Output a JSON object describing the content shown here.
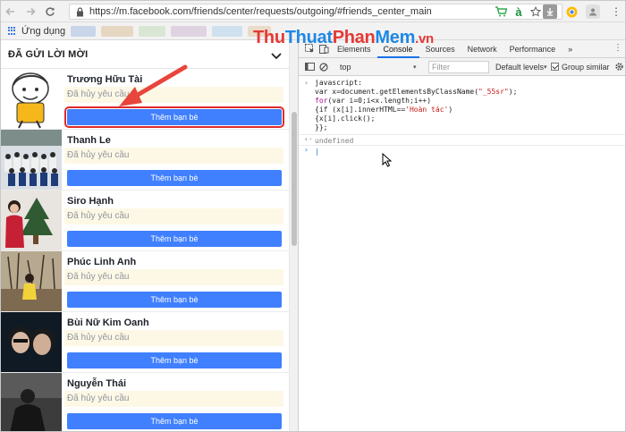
{
  "browser": {
    "url": "https://m.facebook.com/friends/center/requests/outgoing/#friends_center_main",
    "bookmark_apps_label": "Ứng dụng"
  },
  "page": {
    "title": "ĐÃ GỬI LỜI MỜI",
    "requests": [
      {
        "name": "Trương Hữu Tài",
        "status": "Đã hủy yêu cầu",
        "button": "Thêm bạn bè"
      },
      {
        "name": "Thanh Le",
        "status": "Đã hủy yêu cầu",
        "button": "Thêm bạn bè"
      },
      {
        "name": "Siro Hạnh",
        "status": "Đã hủy yêu cầu",
        "button": "Thêm bạn bè"
      },
      {
        "name": "Phúc Linh Anh",
        "status": "Đã hủy yêu cầu",
        "button": "Thêm bạn bè"
      },
      {
        "name": "Bùi Nữ Kim Oanh",
        "status": "Đã hủy yêu cầu",
        "button": "Thêm bạn bè"
      },
      {
        "name": "Nguyễn Thái",
        "status": "Đã hủy yêu cầu",
        "button": "Thêm bạn bè"
      }
    ]
  },
  "devtools": {
    "tabs": [
      "Elements",
      "Console",
      "Sources",
      "Network",
      "Performance"
    ],
    "more": "»",
    "context": "top",
    "filter_placeholder": "Filter",
    "levels": "Default levels",
    "group_similar": "Group similar",
    "code": {
      "l1": "javascript:",
      "l2a": "var x=document.getElementsByClassName(",
      "l2b": "\"_55sr\"",
      "l2c": ");",
      "l3a": "for",
      "l3b": "(var i=0;i<x.length;i++)",
      "l4a": "{if (x[i].innerHTML==",
      "l4b": "'Hoàn tác'",
      "l4c": ")",
      "l5": "{x[i].click();",
      "l6": "}};",
      "result": "undefined"
    }
  },
  "watermark": "ThuThuatPhanMem.vn",
  "colors": {
    "fb_blue": "#4080ff",
    "highlight": "#e02a2a",
    "arrow": "#e8453c"
  }
}
